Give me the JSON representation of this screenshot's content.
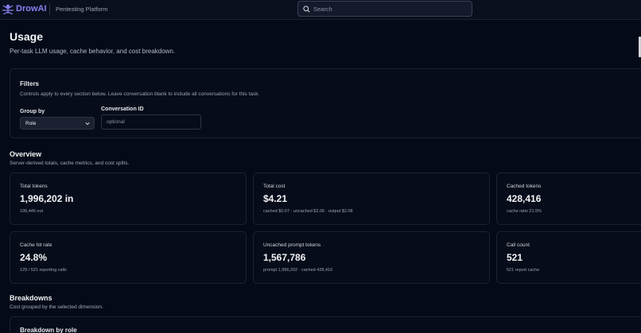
{
  "header": {
    "brand": "DrowAI",
    "platform": "Pentesting Platform",
    "search_placeholder": "Search",
    "accent_color": "#8b7ff0"
  },
  "page": {
    "title": "Usage",
    "subtitle": "Per-task LLM usage, cache behavior, and cost breakdown."
  },
  "filters": {
    "title": "Filters",
    "description": "Controls apply to every section below. Leave conversation blank to include all conversations for this task.",
    "group_by_label": "Group by",
    "group_by_value": "Role",
    "conversation_label": "Conversation ID",
    "conversation_placeholder": "optional"
  },
  "overview": {
    "title": "Overview",
    "description": "Server-derived totals, cache metrics, and cost splits.",
    "cards": [
      {
        "label": "Total tokens",
        "value": "1,996,202 in",
        "detail": "196,446 out"
      },
      {
        "label": "Total cost",
        "value": "$4.21",
        "detail": "cached $0.07 · uncached $2.06 · output $2.08"
      },
      {
        "label": "Cached tokens",
        "value": "428,416",
        "detail": "cache ratio 21.5%"
      },
      {
        "label": "Cache hit rate",
        "value": "24.8%",
        "detail": "129 / 521 reporting calls"
      },
      {
        "label": "Uncached prompt tokens",
        "value": "1,567,786",
        "detail": "prompt 1,996,202 · cached 428,416"
      },
      {
        "label": "Call count",
        "value": "521",
        "detail": "521 report cache"
      }
    ]
  },
  "breakdowns": {
    "title": "Breakdowns",
    "description": "Cost grouped by the selected dimension.",
    "role_title": "Breakdown by role"
  }
}
